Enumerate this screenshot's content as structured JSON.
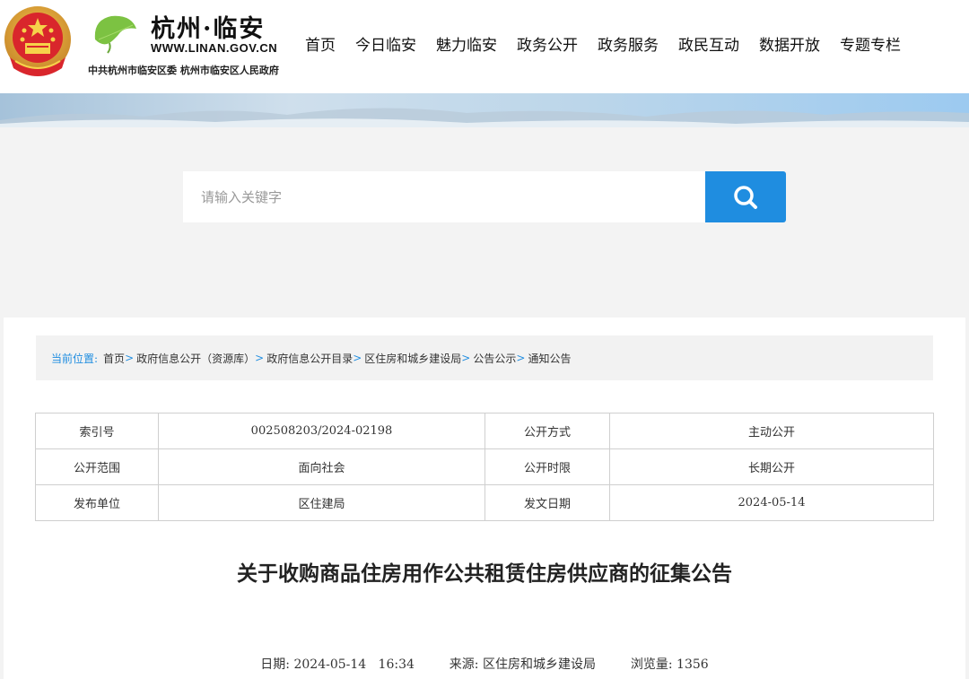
{
  "header": {
    "site_name": "杭州·临安",
    "site_domain": "WWW.LINAN.GOV.CN",
    "site_orgs": "中共杭州市临安区委   杭州市临安区人民政府",
    "nav": [
      "首页",
      "今日临安",
      "魅力临安",
      "政务公开",
      "政务服务",
      "政民互动",
      "数据开放",
      "专题专栏"
    ]
  },
  "search": {
    "placeholder": "请输入关键字"
  },
  "breadcrumb": {
    "label": "当前位置:",
    "items": [
      "首页",
      "政府信息公开（资源库）",
      "政府信息公开目录",
      "区住房和城乡建设局",
      "公告公示",
      "通知公告"
    ],
    "separator": ">"
  },
  "meta": {
    "rows": [
      {
        "k1": "索引号",
        "v1": "002508203/2024-02198",
        "k2": "公开方式",
        "v2": "主动公开"
      },
      {
        "k1": "公开范围",
        "v1": "面向社会",
        "k2": "公开时限",
        "v2": "长期公开"
      },
      {
        "k1": "发布单位",
        "v1": "区住建局",
        "k2": "发文日期",
        "v2": "2024-05-14"
      }
    ]
  },
  "article": {
    "title": "关于收购商品住房用作公共租赁住房供应商的征集公告",
    "date_label": "日期:",
    "date": "2024-05-14   16:34",
    "source_label": "来源:",
    "source": "区住房和城乡建设局",
    "views_label": "浏览量:",
    "views": "1356"
  },
  "colors": {
    "accent": "#1f8de0",
    "banner": "#bcd6ea",
    "page_bg": "#f3f3f3"
  },
  "icons": [
    "national-emblem-icon",
    "ginkgo-leaf-icon",
    "search-icon"
  ]
}
